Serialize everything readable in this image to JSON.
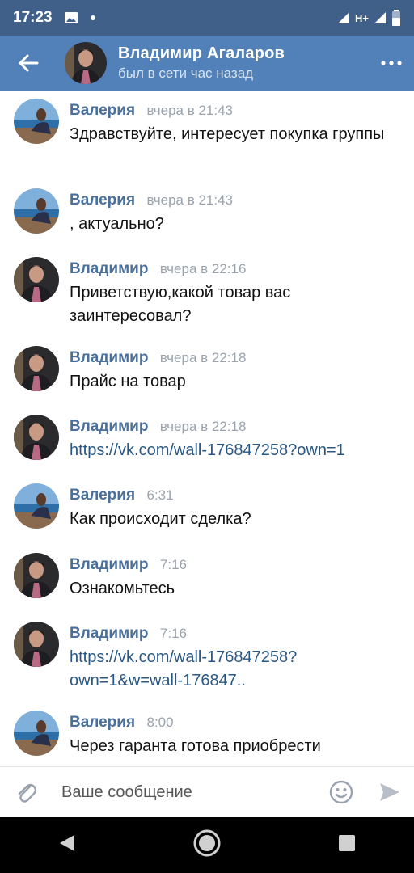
{
  "status": {
    "time": "17:23",
    "network": "H+"
  },
  "header": {
    "name": "Владимир Агаларов",
    "status": "был в сети час назад"
  },
  "messages": [
    {
      "author": "Валерия",
      "time": "вчера в 21:43",
      "text": "Здравствуйте, интересует покупка группы",
      "avatar": "valeria",
      "link": false
    },
    {
      "author": "Валерия",
      "time": "вчера в 21:43",
      "text": ", актуально?",
      "avatar": "valeria",
      "link": false
    },
    {
      "author": "Владимир",
      "time": "вчера в 22:16",
      "text": "Приветствую,какой товар вас заинтересовал?",
      "avatar": "vladimir",
      "link": false
    },
    {
      "author": "Владимир",
      "time": "вчера в 22:18",
      "text": "Прайс на товар",
      "avatar": "vladimir",
      "link": false
    },
    {
      "author": "Владимир",
      "time": "вчера в 22:18",
      "text": "https://vk.com/wall-176847258?own=1",
      "avatar": "vladimir",
      "link": true
    },
    {
      "author": "Валерия",
      "time": "6:31",
      "text": "Как происходит сделка?",
      "avatar": "valeria",
      "link": false
    },
    {
      "author": "Владимир",
      "time": "7:16",
      "text": "Ознакомьтесь",
      "avatar": "vladimir",
      "link": false
    },
    {
      "author": "Владимир",
      "time": "7:16",
      "text": "https://vk.com/wall-176847258? own=1&w=wall-176847..",
      "avatar": "vladimir",
      "link": true
    },
    {
      "author": "Валерия",
      "time": "8:00",
      "text": "Через гаранта готова приобрести",
      "avatar": "valeria",
      "link": false
    }
  ],
  "input": {
    "placeholder": "Ваше сообщение"
  },
  "colors": {
    "header": "#5181b8",
    "statusbar": "#40608a",
    "author": "#4a6f9a",
    "link": "#2a5885"
  }
}
